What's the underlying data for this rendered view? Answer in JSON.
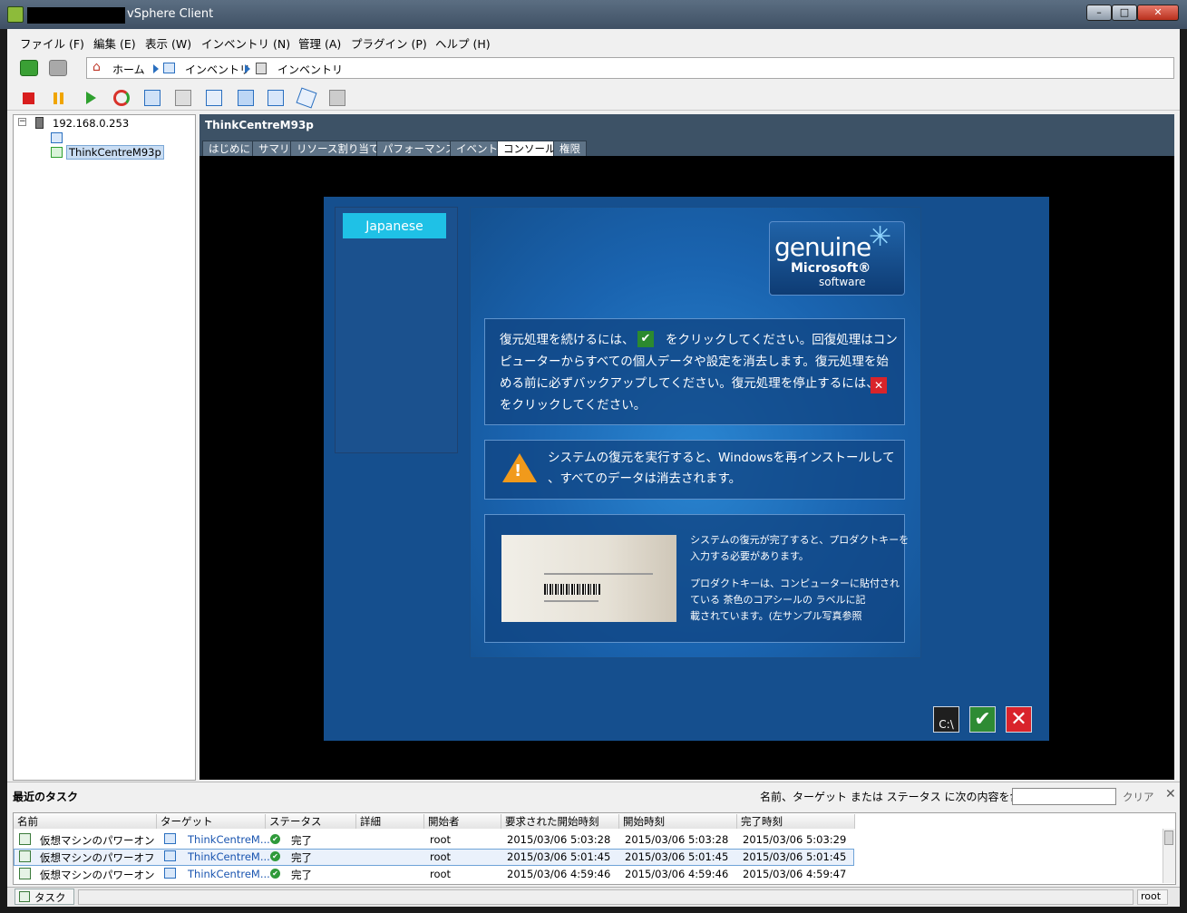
{
  "window": {
    "title": "vSphere Client"
  },
  "menu": [
    "ファイル (F)",
    "編集 (E)",
    "表示 (W)",
    "インベントリ (N)",
    "管理 (A)",
    "プラグイン (P)",
    "ヘルプ (H)"
  ],
  "breadcrumb": {
    "home": "ホーム",
    "inv1": "インベントリ",
    "inv2": "インベントリ"
  },
  "tree": {
    "host": "192.168.0.253",
    "vm": "ThinkCentreM93p"
  },
  "vm_panel": {
    "title": "ThinkCentreM93p",
    "tabs": [
      "はじめに",
      "サマリ",
      "リソース割り当て",
      "パフォーマンス",
      "イベント",
      "コンソール",
      "権限"
    ],
    "active_tab": "コンソール"
  },
  "console": {
    "language": "Japanese",
    "logo": {
      "genuine": "genuine",
      "microsoft": "Microsoft®",
      "software": "software"
    },
    "box1": {
      "line1a": "復元処理を続けるには、",
      "line1b": "をクリックしてください。回復処理はコン",
      "line2": "ピューターからすべての個人データや設定を消去します。復元処理を始",
      "line3": "める前に必ずバックアップしてください。復元処理を停止するには、",
      "line4": "をクリックしてください。"
    },
    "box2": {
      "line1": "システムの復元を実行すると、Windowsを再インストールして",
      "line2": "、すべてのデータは消去されます。"
    },
    "box3": {
      "p1a": "システムの復元が完了すると、プロダクトキーを",
      "p1b": "入力する必要があります。",
      "p2a": "プロダクトキーは、コンピューターに貼付され",
      "p2b": "ている 茶色のコアシールの ラベルに記",
      "p2c": "載されています。(左サンプル写真参照"
    },
    "cmd_label": "C:\\"
  },
  "tasks": {
    "title": "最近のタスク",
    "filter_label": "名前、ターゲット または ステータス に次の内容を含む:",
    "clear": "クリア",
    "columns": [
      "名前",
      "ターゲット",
      "ステータス",
      "詳細",
      "開始者",
      "要求された開始時刻",
      "開始時刻",
      "完了時刻"
    ],
    "rows": [
      {
        "name": "仮想マシンのパワーオン",
        "target": "ThinkCentreM...",
        "status": "完了",
        "initiator": "root",
        "requested": "2015/03/06 5:03:28",
        "start": "2015/03/06 5:03:28",
        "end": "2015/03/06 5:03:29"
      },
      {
        "name": "仮想マシンのパワーオフ",
        "target": "ThinkCentreM...",
        "status": "完了",
        "initiator": "root",
        "requested": "2015/03/06 5:01:45",
        "start": "2015/03/06 5:01:45",
        "end": "2015/03/06 5:01:45"
      },
      {
        "name": "仮想マシンのパワーオン",
        "target": "ThinkCentreM...",
        "status": "完了",
        "initiator": "root",
        "requested": "2015/03/06 4:59:46",
        "start": "2015/03/06 4:59:46",
        "end": "2015/03/06 4:59:47"
      }
    ]
  },
  "statusbar": {
    "tasks": "タスク",
    "user": "root"
  },
  "colors": {
    "titlebar": "#4a5d72",
    "console_bg": "#154f8e",
    "accent_cyan": "#1fc1e6",
    "ok_green": "#2e8b34",
    "cancel_red": "#d9232b"
  }
}
